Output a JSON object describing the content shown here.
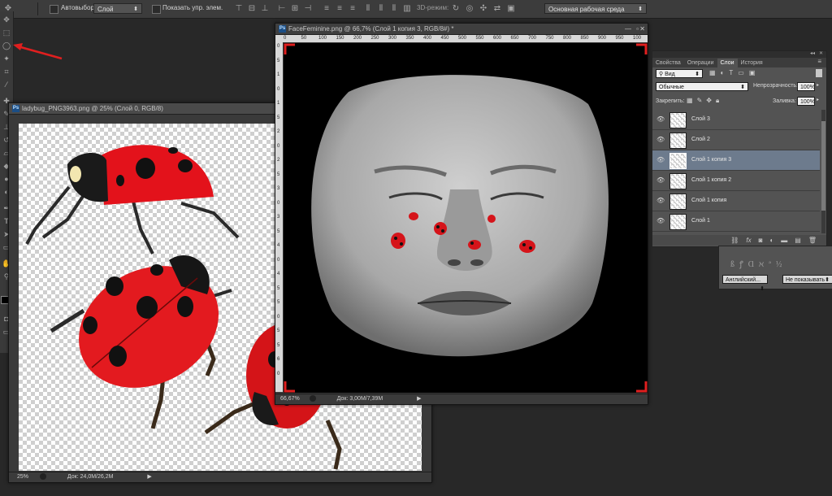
{
  "optionsbar": {
    "autoselect_label": "Автовыбор:",
    "autoselect_value": "Слой",
    "show_transform_label": "Показать упр. элем.",
    "mode3d_label": "3D-режим:",
    "workspace_value": "Основная рабочая среда"
  },
  "ladybug_doc": {
    "title": "ladybug_PNG3963.png @ 25% (Слой 0, RGB/8)",
    "zoom": "25%",
    "doc_info": "Док: 24,0M/26,2M"
  },
  "face_doc": {
    "title": "FaceFeminine.png @ 66,7% (Слой 1 копия 3, RGB/8#) *",
    "zoom": "66,67%",
    "doc_info": "Док: 3,00M/7,39M",
    "ruler_h": [
      "0",
      "50",
      "100",
      "150",
      "200",
      "250",
      "300",
      "350",
      "400",
      "450",
      "500",
      "550",
      "600",
      "650",
      "700",
      "750",
      "800",
      "850",
      "900",
      "950",
      "100"
    ],
    "ruler_v": [
      "0",
      "5",
      "1",
      "0",
      "1",
      "5",
      "2",
      "0",
      "2",
      "5",
      "3",
      "0",
      "3",
      "5",
      "4",
      "0",
      "4",
      "5",
      "5",
      "0",
      "5",
      "5",
      "6",
      "0"
    ]
  },
  "layers_panel": {
    "tabs": [
      "Свойства",
      "Операции",
      "Слои",
      "История"
    ],
    "active_tab": "Слои",
    "filter_value": "Вид",
    "blend_value": "Обычные",
    "opacity_label": "Непрозрачность:",
    "opacity_value": "100%",
    "lock_label": "Закрепить:",
    "fill_label": "Заливка:",
    "fill_value": "100%",
    "layers": [
      "Слой 3",
      "Слой 2",
      "Слой 1 копия 3",
      "Слой 1 копия 2",
      "Слой 1 копия",
      "Слой 1"
    ],
    "selected_layer": "Слой 1 копия 3",
    "footer_icons": [
      "link-icon",
      "fx-icon",
      "mask-icon",
      "adjustment-icon",
      "group-icon",
      "new-layer-icon",
      "trash-icon"
    ]
  },
  "char_panel": {
    "language_value": "Английский...",
    "aa_value": "Не показывать"
  },
  "colors": {
    "accent_red": "#e01f1f",
    "selected_layer_bg": "#6d7b8d"
  }
}
